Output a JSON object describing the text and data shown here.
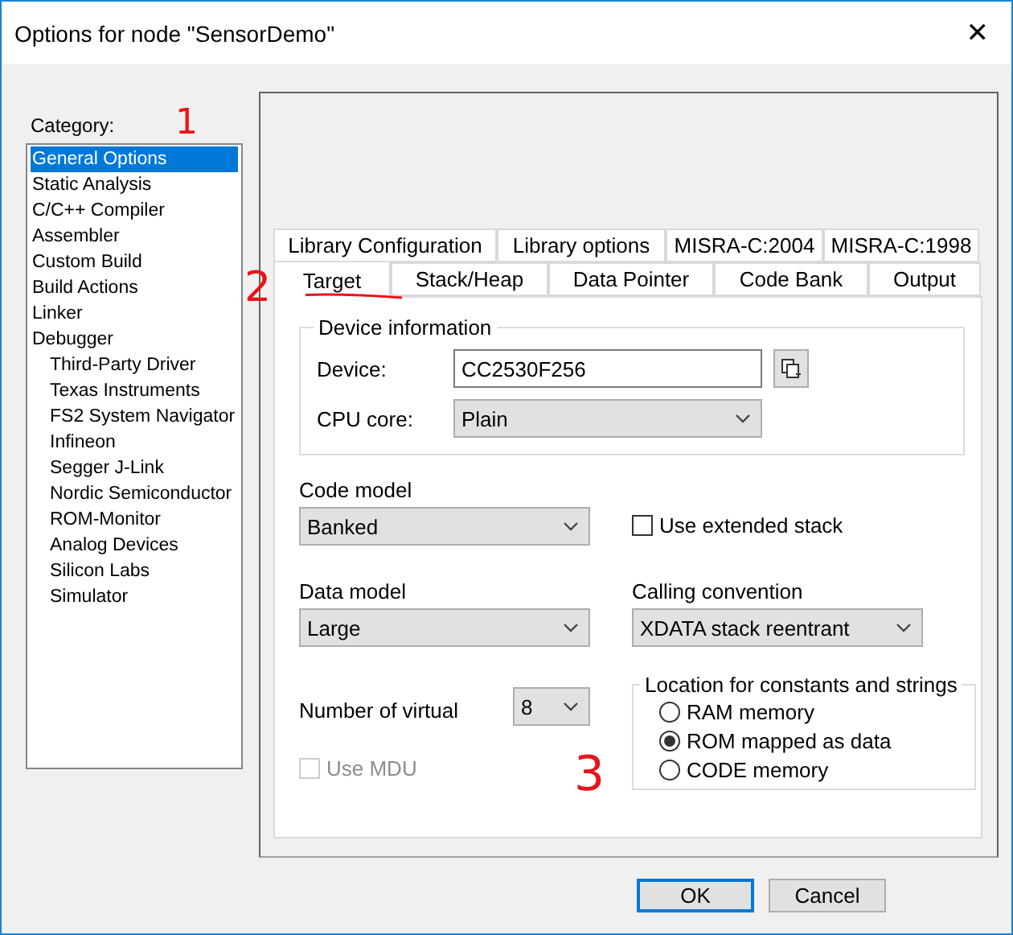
{
  "window": {
    "title": "Options for node \"SensorDemo\"",
    "close": "✕"
  },
  "category": {
    "label": "Category:",
    "items": [
      {
        "label": "General Options",
        "selected": true
      },
      {
        "label": "Static Analysis",
        "selected": false
      },
      {
        "label": "C/C++ Compiler",
        "selected": false
      },
      {
        "label": "Assembler",
        "selected": false
      },
      {
        "label": "Custom Build",
        "selected": false
      },
      {
        "label": "Build Actions",
        "selected": false
      },
      {
        "label": "Linker",
        "selected": false
      },
      {
        "label": "Debugger",
        "selected": false,
        "children": [
          {
            "label": "Third-Party Driver",
            "selected": false
          },
          {
            "label": "Texas Instruments",
            "selected": false
          },
          {
            "label": "FS2 System Navigator",
            "selected": false
          },
          {
            "label": "Infineon",
            "selected": false
          },
          {
            "label": "Segger J-Link",
            "selected": false
          },
          {
            "label": "Nordic Semiconductor",
            "selected": false
          },
          {
            "label": "ROM-Monitor",
            "selected": false
          },
          {
            "label": "Analog Devices",
            "selected": false
          },
          {
            "label": "Silicon Labs",
            "selected": false
          },
          {
            "label": "Simulator",
            "selected": false
          }
        ]
      }
    ]
  },
  "tab_rows": [
    [
      {
        "label": "Library Configuration",
        "selected": false
      },
      {
        "label": "Library options",
        "selected": false
      },
      {
        "label": "MISRA-C:2004",
        "selected": false
      },
      {
        "label": "MISRA-C:1998",
        "selected": false
      }
    ],
    [
      {
        "label": "Target",
        "selected": true
      },
      {
        "label": "Stack/Heap",
        "selected": false
      },
      {
        "label": "Data Pointer",
        "selected": false
      },
      {
        "label": "Code Bank",
        "selected": false
      },
      {
        "label": "Output",
        "selected": false
      }
    ]
  ],
  "device_information": {
    "title": "Device information",
    "device_label": "Device:",
    "device": "CC2530F256",
    "cpu_core_label": "CPU core:",
    "cpu_core": "Plain"
  },
  "code_model": {
    "label": "Code model",
    "value": "Banked"
  },
  "use_extended_stack": {
    "label": "Use extended stack",
    "checked": false,
    "disabled": false
  },
  "data_model": {
    "label": "Data model",
    "value": "Large"
  },
  "calling_convention": {
    "label": "Calling convention",
    "value": "XDATA stack reentrant"
  },
  "number_of_virtual": {
    "label": "Number of virtual",
    "value": "8"
  },
  "use_mdu": {
    "label": "Use MDU",
    "checked": false,
    "disabled": true
  },
  "location": {
    "title": "Location for constants and strings",
    "options": [
      {
        "label": "RAM memory",
        "selected": false
      },
      {
        "label": "ROM mapped as data",
        "selected": true
      },
      {
        "label": "CODE memory",
        "selected": false
      }
    ]
  },
  "buttons": [
    {
      "label": "OK",
      "default": true
    },
    {
      "label": "Cancel",
      "default": false
    }
  ],
  "annotations": [
    {
      "text": "1"
    },
    {
      "text": "2"
    },
    {
      "text": "3"
    }
  ]
}
